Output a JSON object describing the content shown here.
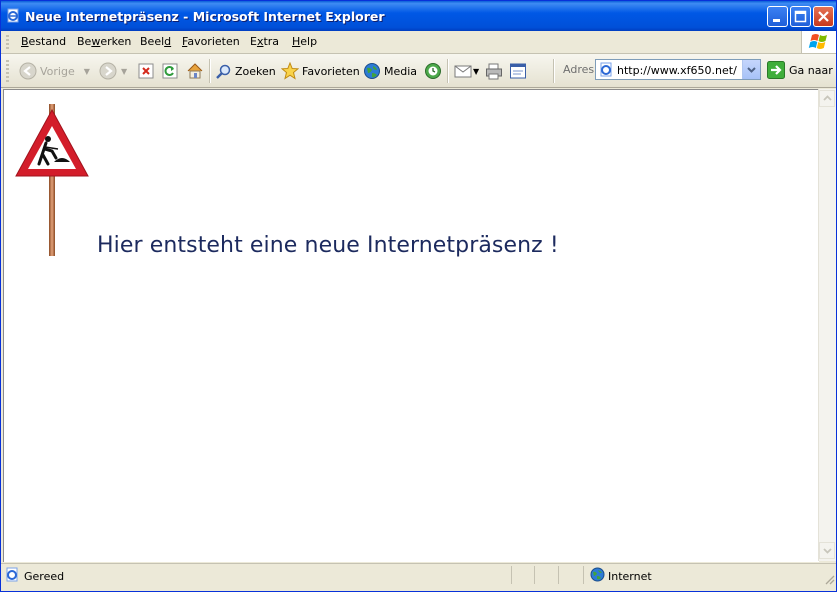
{
  "window": {
    "title": "Neue Internetpräsenz - Microsoft Internet Explorer"
  },
  "menu": [
    {
      "pre": "",
      "key": "B",
      "post": "estand"
    },
    {
      "pre": "Be",
      "key": "w",
      "post": "erken"
    },
    {
      "pre": "Beel",
      "key": "d",
      "post": ""
    },
    {
      "pre": "",
      "key": "F",
      "post": "avorieten"
    },
    {
      "pre": "E",
      "key": "x",
      "post": "tra"
    },
    {
      "pre": "",
      "key": "H",
      "post": "elp"
    }
  ],
  "toolbar": {
    "back_label": "Vorige",
    "search_label": "Zoeken",
    "favorites_label": "Favorieten",
    "media_label": "Media"
  },
  "address": {
    "label": "Adres",
    "url": "http://www.xf650.net/",
    "go_label": "Ga naar"
  },
  "page": {
    "headline": "Hier entsteht eine neue Internetpräsenz !"
  },
  "status": {
    "text": "Gereed",
    "zone": "Internet"
  }
}
